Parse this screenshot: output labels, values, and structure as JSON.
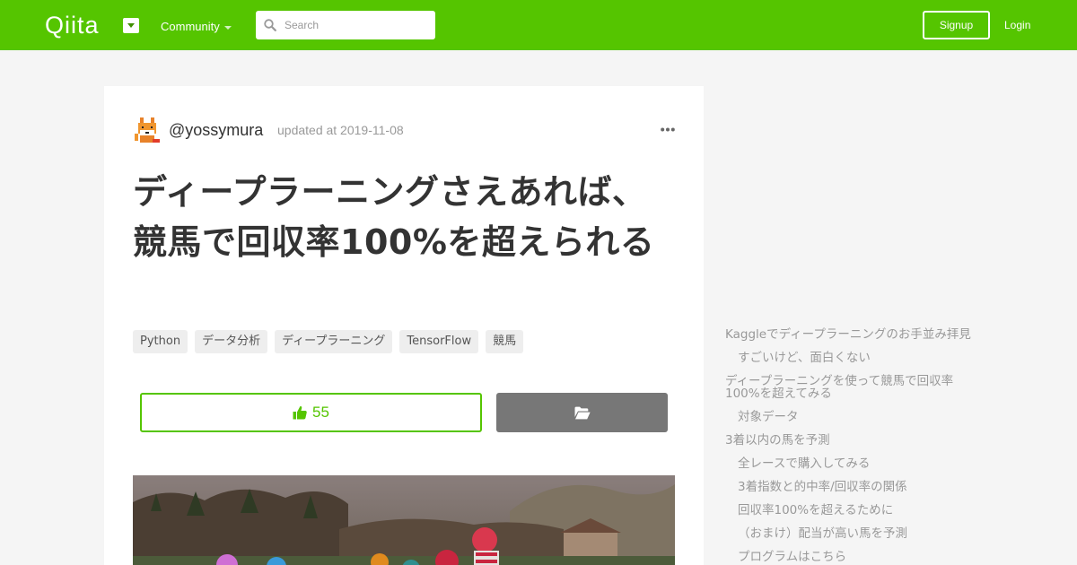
{
  "header": {
    "logo": "Qiita",
    "community_label": "Community",
    "search_placeholder": "Search",
    "signup_label": "Signup",
    "login_label": "Login"
  },
  "article": {
    "author": "@yossymura",
    "updated": "updated at 2019-11-08",
    "title": "ディープラーニングさえあれば、競馬で回収率100%を超えられる",
    "tags": [
      "Python",
      "データ分析",
      "ディープラーニング",
      "TensorFlow",
      "競馬"
    ],
    "like_count": "55"
  },
  "toc": {
    "items": [
      {
        "label": "Kaggleでディープラーニングのお手並み拝見",
        "level": 1
      },
      {
        "label": "すごいけど、面白くない",
        "level": 2
      },
      {
        "label": "ディープラーニングを使って競馬で回収率",
        "level": 1
      },
      {
        "label": "100%を超えてみる",
        "level": 1
      },
      {
        "label": "対象データ",
        "level": 2
      },
      {
        "label": "3着以内の馬を予測",
        "level": 1
      },
      {
        "label": "全レースで購入してみる",
        "level": 2
      },
      {
        "label": "3着指数と的中率/回収率の関係",
        "level": 2
      },
      {
        "label": "回収率100%を超えるために",
        "level": 2
      },
      {
        "label": "（おまけ）配当が高い馬を予測",
        "level": 2
      },
      {
        "label": "プログラムはこちら",
        "level": 2
      }
    ]
  },
  "colors": {
    "brand": "#55c500",
    "stock_button": "#777777"
  },
  "icons": {
    "like": "thumbs-up-icon",
    "stock": "folder-open-icon",
    "search": "search-icon",
    "more": "ellipsis-icon",
    "avatar": "fox-pixel-avatar"
  }
}
